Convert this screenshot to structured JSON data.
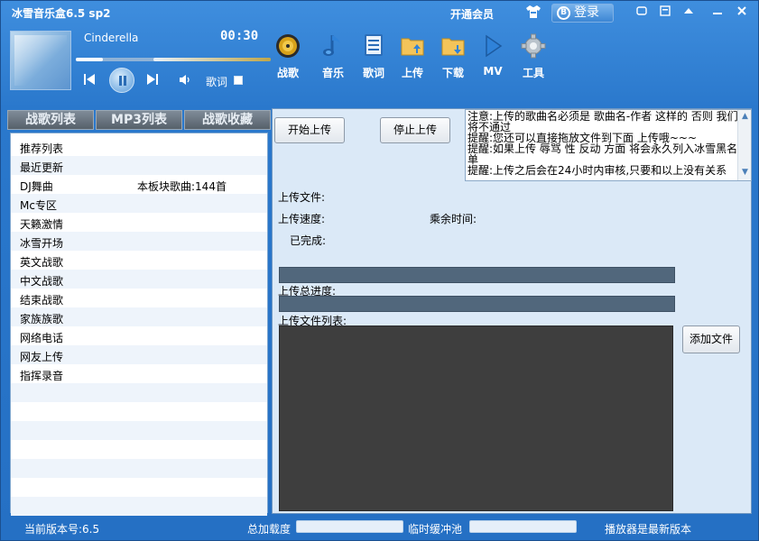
{
  "app": {
    "title": "冰雪音乐盒6.5 sp2",
    "vip_label": "开通会员",
    "login_label": "登录",
    "login_badge": "B"
  },
  "player": {
    "song": "Cinderella",
    "time": "00:30",
    "lyric_label": "歌词",
    "lyric_checked": false
  },
  "toolbar": [
    {
      "label": "战歌",
      "icon": "disc-icon"
    },
    {
      "label": "音乐",
      "icon": "music-note-icon"
    },
    {
      "label": "歌词",
      "icon": "lyrics-icon"
    },
    {
      "label": "上传",
      "icon": "upload-folder-icon"
    },
    {
      "label": "下载",
      "icon": "download-folder-icon"
    },
    {
      "label": "MV",
      "icon": "play-icon"
    },
    {
      "label": "工具",
      "icon": "gear-icon"
    }
  ],
  "tabs": [
    "战歌列表",
    "MP3列表",
    "战歌收藏"
  ],
  "playlist": [
    {
      "name": "推荐列表",
      "extra": ""
    },
    {
      "name": "最近更新",
      "extra": ""
    },
    {
      "name": "DJ舞曲",
      "extra": "本板块歌曲:144首"
    },
    {
      "name": "Mc专区",
      "extra": ""
    },
    {
      "name": "天籁激情",
      "extra": ""
    },
    {
      "name": "冰雪开场",
      "extra": ""
    },
    {
      "name": "英文战歌",
      "extra": ""
    },
    {
      "name": "中文战歌",
      "extra": ""
    },
    {
      "name": "结束战歌",
      "extra": ""
    },
    {
      "name": "家族族歌",
      "extra": ""
    },
    {
      "name": "网络电话",
      "extra": ""
    },
    {
      "name": "网友上传",
      "extra": ""
    },
    {
      "name": "指挥录音",
      "extra": ""
    }
  ],
  "upload": {
    "start_button": "开始上传",
    "stop_button": "停止上传",
    "notice": [
      "注意:上传的歌曲名必须是 歌曲名-作者 这样的 否则 我们将不通过",
      "提醒:您还可以直接拖放文件到下面 上传哦~~~",
      "提醒:如果上传 辱骂 性 反动 方面 将会永久列入冰雪黑名单",
      "提醒:上传之后会在24小时内审核,只要和以上没有关系"
    ],
    "file_label": "上传文件:",
    "speed_label": "上传速度:",
    "remaining_label": "乘余时间:",
    "done_label": "已完成:",
    "total_progress_label": "上传总进度:",
    "file_list_label": "上传文件列表:",
    "add_file_button": "添加文件"
  },
  "status": {
    "version": "当前版本号:6.5",
    "total_load": "总加载度",
    "buffer": "临时缓冲池",
    "latest": "播放器是最新版本"
  },
  "colors": {
    "window_blue": "#2a78cc",
    "panel_bg": "#dbe9f7",
    "progress_bar": "#51677c",
    "file_list_bg": "#3e3e3e"
  }
}
